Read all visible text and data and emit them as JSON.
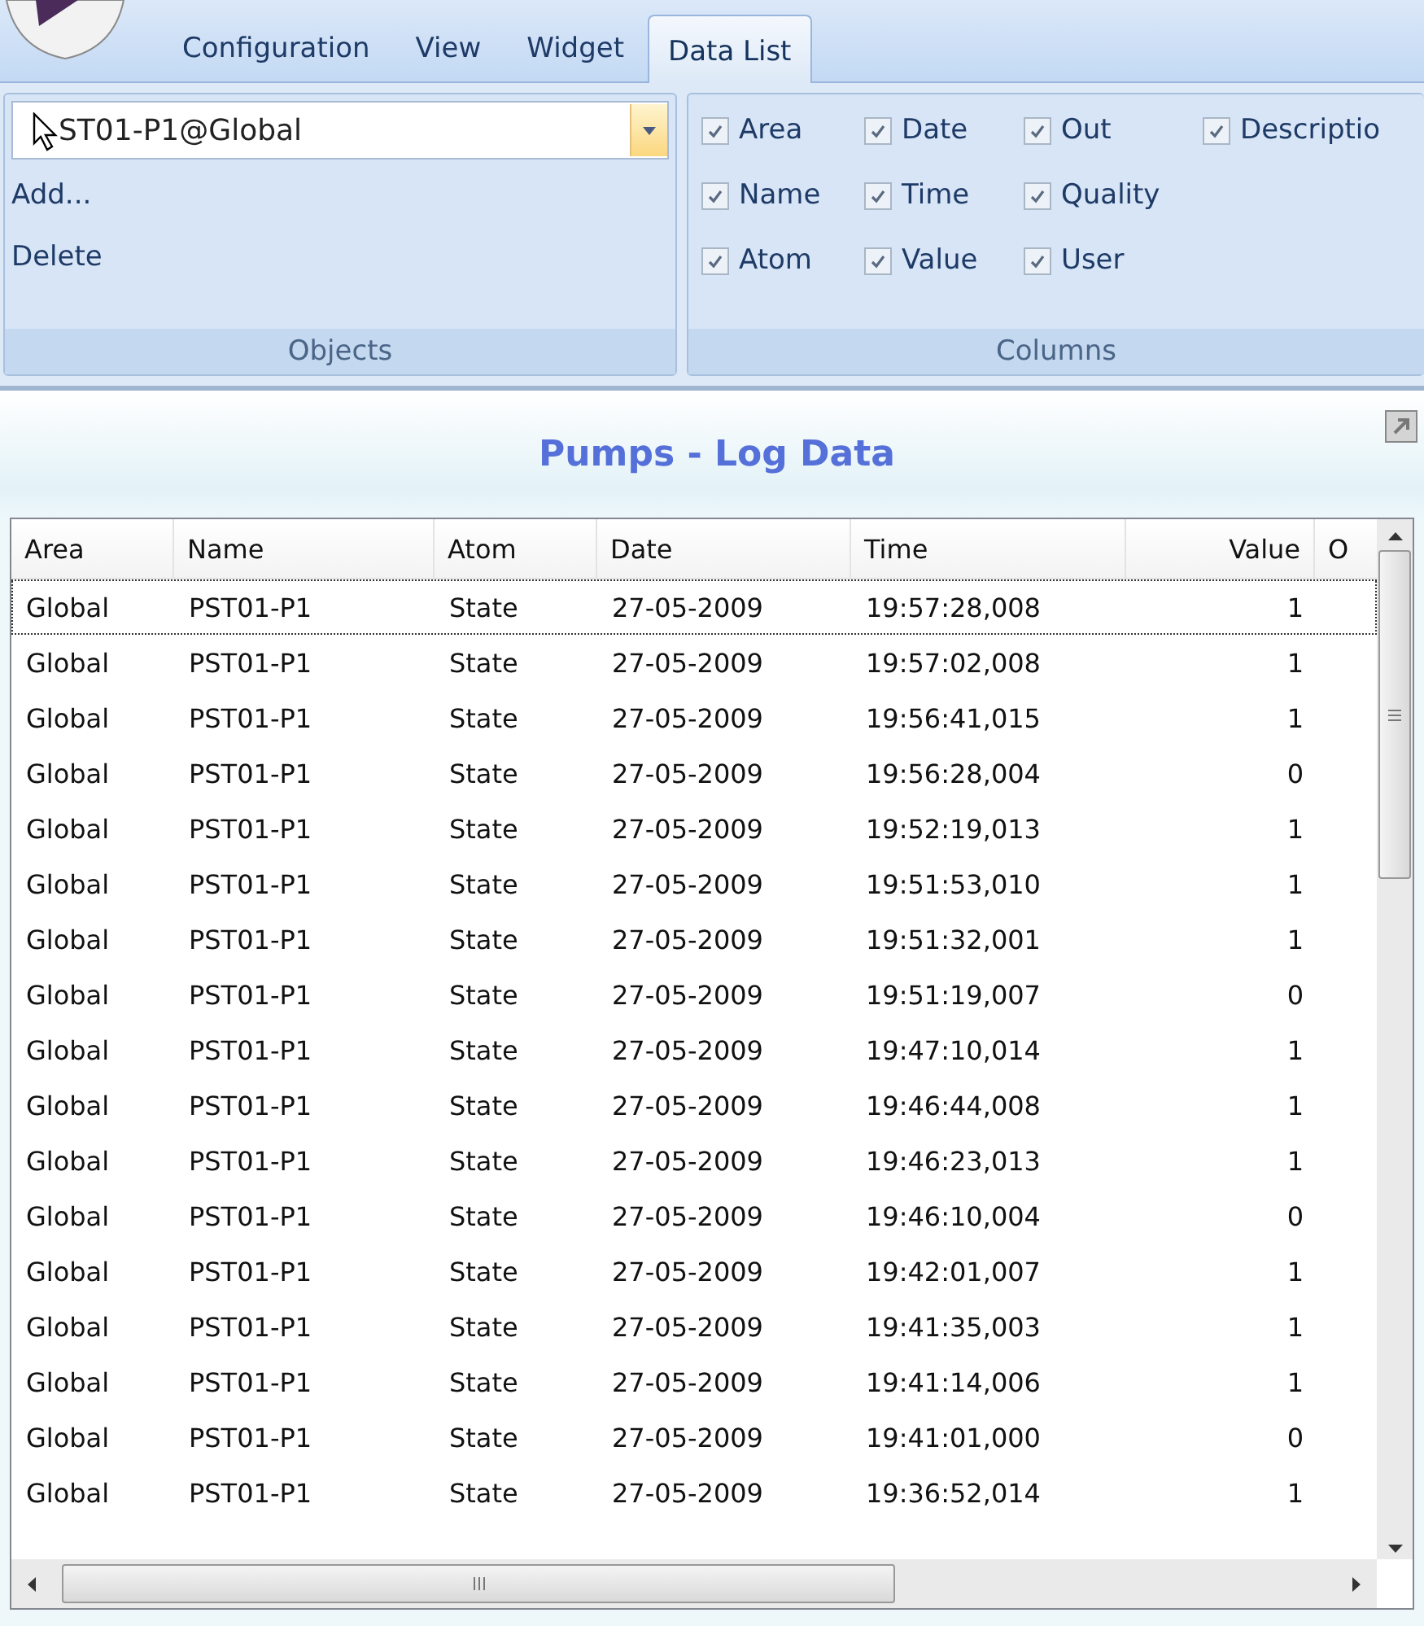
{
  "ribbon": {
    "tabs": [
      {
        "label": "Configuration",
        "selected": false
      },
      {
        "label": "View",
        "selected": false
      },
      {
        "label": "Widget",
        "selected": false
      },
      {
        "label": "Data List",
        "selected": true
      }
    ],
    "objects": {
      "combo_value": "ST01-P1@Global",
      "actions": [
        "Add...",
        "Delete"
      ],
      "caption": "Objects"
    },
    "columns": {
      "checks": [
        {
          "label": "Area",
          "checked": true
        },
        {
          "label": "Date",
          "checked": true
        },
        {
          "label": "Out",
          "checked": true
        },
        {
          "label": "Descriptio",
          "checked": true
        },
        {
          "label": "Name",
          "checked": true
        },
        {
          "label": "Time",
          "checked": true
        },
        {
          "label": "Quality",
          "checked": true
        },
        {
          "label": "Atom",
          "checked": true
        },
        {
          "label": "Value",
          "checked": true
        },
        {
          "label": "User",
          "checked": true
        }
      ],
      "caption": "Columns"
    }
  },
  "panel": {
    "title": "Pumps - Log Data"
  },
  "table": {
    "columns": [
      "Area",
      "Name",
      "Atom",
      "Date",
      "Time",
      "Value",
      "O"
    ],
    "rows": [
      {
        "cells": [
          "Global",
          "PST01-P1",
          "State",
          "27-05-2009",
          "19:57:28,008",
          "1"
        ],
        "selected": true
      },
      {
        "cells": [
          "Global",
          "PST01-P1",
          "State",
          "27-05-2009",
          "19:57:02,008",
          "1"
        ],
        "selected": false
      },
      {
        "cells": [
          "Global",
          "PST01-P1",
          "State",
          "27-05-2009",
          "19:56:41,015",
          "1"
        ],
        "selected": false
      },
      {
        "cells": [
          "Global",
          "PST01-P1",
          "State",
          "27-05-2009",
          "19:56:28,004",
          "0"
        ],
        "selected": false
      },
      {
        "cells": [
          "Global",
          "PST01-P1",
          "State",
          "27-05-2009",
          "19:52:19,013",
          "1"
        ],
        "selected": false
      },
      {
        "cells": [
          "Global",
          "PST01-P1",
          "State",
          "27-05-2009",
          "19:51:53,010",
          "1"
        ],
        "selected": false
      },
      {
        "cells": [
          "Global",
          "PST01-P1",
          "State",
          "27-05-2009",
          "19:51:32,001",
          "1"
        ],
        "selected": false
      },
      {
        "cells": [
          "Global",
          "PST01-P1",
          "State",
          "27-05-2009",
          "19:51:19,007",
          "0"
        ],
        "selected": false
      },
      {
        "cells": [
          "Global",
          "PST01-P1",
          "State",
          "27-05-2009",
          "19:47:10,014",
          "1"
        ],
        "selected": false
      },
      {
        "cells": [
          "Global",
          "PST01-P1",
          "State",
          "27-05-2009",
          "19:46:44,008",
          "1"
        ],
        "selected": false
      },
      {
        "cells": [
          "Global",
          "PST01-P1",
          "State",
          "27-05-2009",
          "19:46:23,013",
          "1"
        ],
        "selected": false
      },
      {
        "cells": [
          "Global",
          "PST01-P1",
          "State",
          "27-05-2009",
          "19:46:10,004",
          "0"
        ],
        "selected": false
      },
      {
        "cells": [
          "Global",
          "PST01-P1",
          "State",
          "27-05-2009",
          "19:42:01,007",
          "1"
        ],
        "selected": false
      },
      {
        "cells": [
          "Global",
          "PST01-P1",
          "State",
          "27-05-2009",
          "19:41:35,003",
          "1"
        ],
        "selected": false
      },
      {
        "cells": [
          "Global",
          "PST01-P1",
          "State",
          "27-05-2009",
          "19:41:14,006",
          "1"
        ],
        "selected": false
      },
      {
        "cells": [
          "Global",
          "PST01-P1",
          "State",
          "27-05-2009",
          "19:41:01,000",
          "0"
        ],
        "selected": false
      },
      {
        "cells": [
          "Global",
          "PST01-P1",
          "State",
          "27-05-2009",
          "19:36:52,014",
          "1"
        ],
        "selected": false
      }
    ]
  }
}
